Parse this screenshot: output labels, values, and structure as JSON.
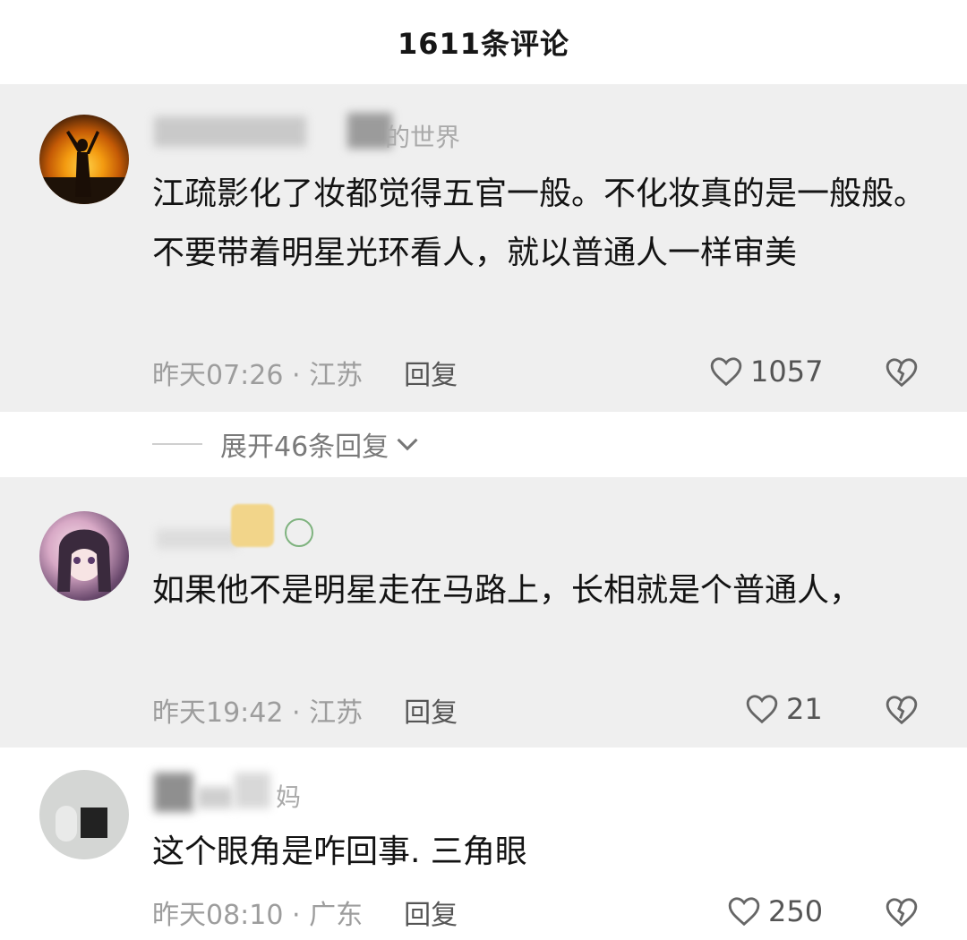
{
  "header": {
    "title": "1611条评论"
  },
  "comments": [
    {
      "name_visible": "的世界",
      "text": "江疏影化了妆都觉得五官一般。不化妆真的是一般般。不要带着明星光环看人，就以普通人一样审美",
      "time": "昨天07:26 · 江苏",
      "reply_label": "回复",
      "likes": "1057",
      "expand_label": "展开46条回复"
    },
    {
      "name_visible": "",
      "text": "如果他不是明星走在马路上，长相就是个普通人，",
      "time": "昨天19:42 · 江苏",
      "reply_label": "回复",
      "likes": "21"
    },
    {
      "name_visible": "妈",
      "text": "这个眼角是咋回事. 三角眼",
      "time": "昨天08:10 · 广东",
      "reply_label": "回复",
      "likes": "250"
    }
  ]
}
